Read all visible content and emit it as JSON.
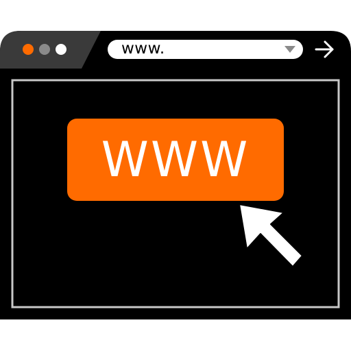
{
  "browser": {
    "address_bar": {
      "value": "www.",
      "dropdown_icon": "triangle-down-icon"
    },
    "go_icon": "arrow-right-icon",
    "window_controls": [
      {
        "name": "close-dot",
        "color": "#ff6b00"
      },
      {
        "name": "minimize-dot",
        "color": "#8a8a8a"
      },
      {
        "name": "maximize-dot",
        "color": "#ffffff"
      }
    ]
  },
  "content": {
    "www_button": {
      "label": "WWW"
    },
    "cursor_icon": "cursor-arrow-icon"
  },
  "colors": {
    "accent": "#ff6b00",
    "frame": "#000000",
    "title_bar_dark": "#3a3a3a",
    "inner_border": "#c8c8c8",
    "background": "#ffffff"
  }
}
